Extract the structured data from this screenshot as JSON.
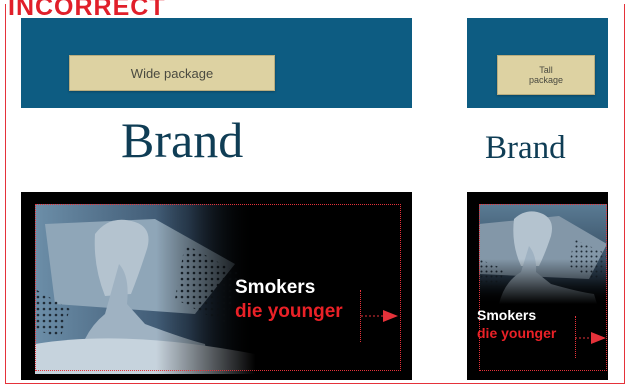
{
  "heading": "INCORRECT",
  "wide_package": {
    "label": "Wide package",
    "brand": "Brand",
    "warning_line1": "Smokers",
    "warning_line2": "die younger"
  },
  "tall_package": {
    "label": "Tall package",
    "brand": "Brand",
    "warning_line1": "Smokers",
    "warning_line2": "die younger"
  },
  "colors": {
    "accent_red": "#e5323a",
    "band_blue": "#0d5c82",
    "label_tan": "#ddd2a2",
    "brand_navy": "#0f3d55"
  }
}
